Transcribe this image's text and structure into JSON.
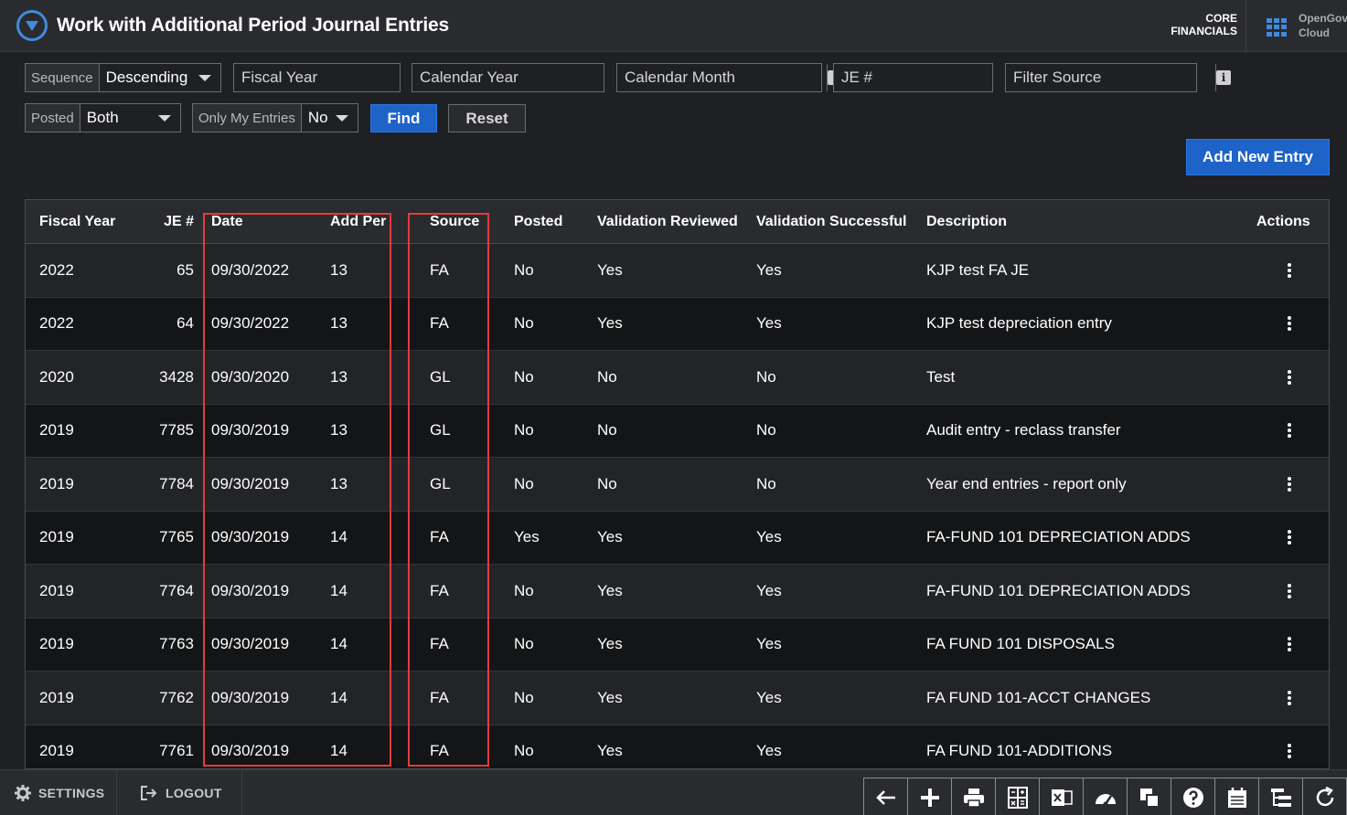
{
  "header": {
    "title": "Work with Additional Period Journal Entries",
    "product_line1": "CORE",
    "product_line2": "FINANCIALS",
    "brand_line1": "OpenGov",
    "brand_line2": "Cloud"
  },
  "filters": {
    "sequence_label": "Sequence",
    "sequence_value": "Descending",
    "fiscal_year_placeholder": "Fiscal Year",
    "calendar_year_placeholder": "Calendar Year",
    "calendar_month_placeholder": "Calendar Month",
    "je_placeholder": "JE #",
    "filter_source_placeholder": "Filter Source",
    "info_glyph": "i",
    "posted_label": "Posted",
    "posted_value": "Both",
    "only_my_label": "Only My Entries",
    "only_my_value": "No",
    "find_label": "Find",
    "reset_label": "Reset"
  },
  "add_new_label": "Add New Entry",
  "table": {
    "headers": {
      "fiscal_year": "Fiscal Year",
      "je": "JE #",
      "date": "Date",
      "add_per": "Add Per",
      "source": "Source",
      "posted": "Posted",
      "validation_reviewed": "Validation Reviewed",
      "validation_successful": "Validation Successful",
      "description": "Description",
      "actions": "Actions"
    },
    "rows": [
      {
        "fy": "2022",
        "je": "65",
        "date": "09/30/2022",
        "per": "13",
        "src": "FA",
        "posted": "No",
        "vr": "Yes",
        "vs": "Yes",
        "desc": "KJP test FA JE"
      },
      {
        "fy": "2022",
        "je": "64",
        "date": "09/30/2022",
        "per": "13",
        "src": "FA",
        "posted": "No",
        "vr": "Yes",
        "vs": "Yes",
        "desc": "KJP test depreciation entry"
      },
      {
        "fy": "2020",
        "je": "3428",
        "date": "09/30/2020",
        "per": "13",
        "src": "GL",
        "posted": "No",
        "vr": "No",
        "vs": "No",
        "desc": "Test"
      },
      {
        "fy": "2019",
        "je": "7785",
        "date": "09/30/2019",
        "per": "13",
        "src": "GL",
        "posted": "No",
        "vr": "No",
        "vs": "No",
        "desc": "Audit entry - reclass transfer"
      },
      {
        "fy": "2019",
        "je": "7784",
        "date": "09/30/2019",
        "per": "13",
        "src": "GL",
        "posted": "No",
        "vr": "No",
        "vs": "No",
        "desc": "Year end entries - report only"
      },
      {
        "fy": "2019",
        "je": "7765",
        "date": "09/30/2019",
        "per": "14",
        "src": "FA",
        "posted": "Yes",
        "vr": "Yes",
        "vs": "Yes",
        "desc": "FA-FUND 101 DEPRECIATION ADDS"
      },
      {
        "fy": "2019",
        "je": "7764",
        "date": "09/30/2019",
        "per": "14",
        "src": "FA",
        "posted": "No",
        "vr": "Yes",
        "vs": "Yes",
        "desc": "FA-FUND 101 DEPRECIATION ADDS"
      },
      {
        "fy": "2019",
        "je": "7763",
        "date": "09/30/2019",
        "per": "14",
        "src": "FA",
        "posted": "No",
        "vr": "Yes",
        "vs": "Yes",
        "desc": "FA FUND 101 DISPOSALS"
      },
      {
        "fy": "2019",
        "je": "7762",
        "date": "09/30/2019",
        "per": "14",
        "src": "FA",
        "posted": "No",
        "vr": "Yes",
        "vs": "Yes",
        "desc": "FA FUND 101-ACCT CHANGES"
      },
      {
        "fy": "2019",
        "je": "7761",
        "date": "09/30/2019",
        "per": "14",
        "src": "FA",
        "posted": "No",
        "vr": "Yes",
        "vs": "Yes",
        "desc": "FA FUND 101-ADDITIONS"
      }
    ]
  },
  "footer": {
    "settings_label": "SETTINGS",
    "logout_label": "LOGOUT",
    "tools": [
      "back-arrow-icon",
      "plus-icon",
      "print-icon",
      "calculator-icon",
      "excel-icon",
      "speed-icon",
      "copy-icon",
      "help-icon",
      "calendar-icon",
      "tree-icon",
      "refresh-icon"
    ]
  },
  "colors": {
    "accent": "#1d63c8",
    "highlight": "#e23c3c"
  }
}
